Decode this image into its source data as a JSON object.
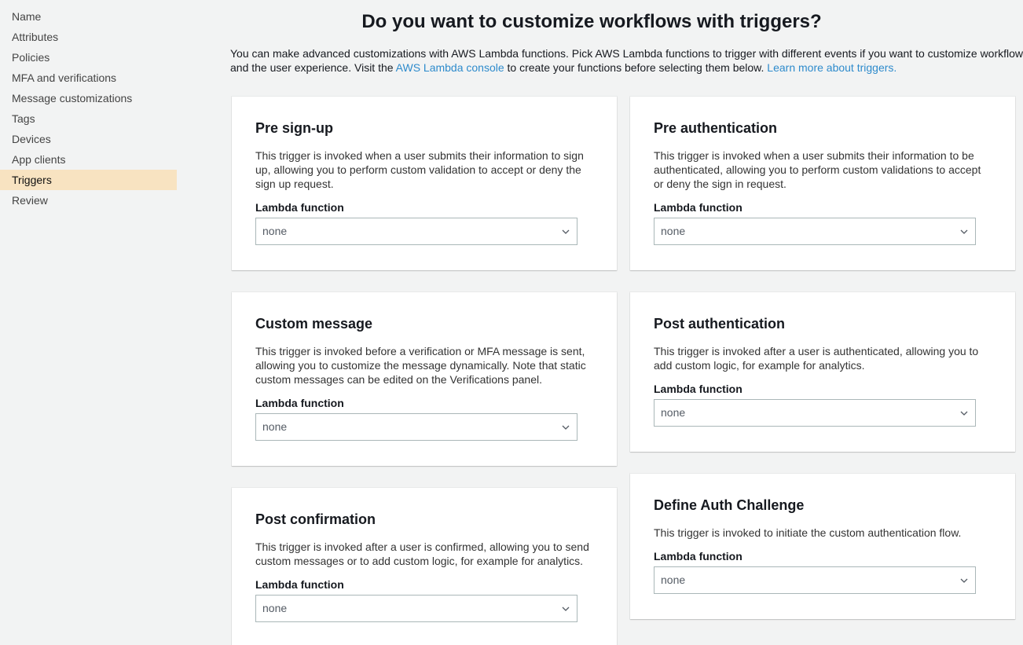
{
  "sidebar": {
    "items": [
      {
        "label": "Name"
      },
      {
        "label": "Attributes"
      },
      {
        "label": "Policies"
      },
      {
        "label": "MFA and verifications"
      },
      {
        "label": "Message customizations"
      },
      {
        "label": "Tags"
      },
      {
        "label": "Devices"
      },
      {
        "label": "App clients"
      },
      {
        "label": "Triggers",
        "active": true
      },
      {
        "label": "Review"
      }
    ]
  },
  "main": {
    "title": "Do you want to customize workflows with triggers?",
    "intro": {
      "line1": "You can make advanced customizations with AWS Lambda functions. Pick AWS Lambda functions to trigger with different events if you want to customize workflows",
      "line2_pre": "and the user experience. Visit the ",
      "link1": "AWS Lambda console",
      "line2_mid": " to create your functions before selecting them below. ",
      "link2": "Learn more about triggers."
    }
  },
  "triggers": {
    "field_label": "Lambda function",
    "pre_signup": {
      "title": "Pre sign-up",
      "description": "This trigger is invoked when a user submits their information to sign up, allowing you to perform custom validation to accept or deny the sign up request.",
      "value": "none"
    },
    "pre_auth": {
      "title": "Pre authentication",
      "description": "This trigger is invoked when a user submits their information to be authenticated, allowing you to perform custom validations to accept or deny the sign in request.",
      "value": "none"
    },
    "custom_message": {
      "title": "Custom message",
      "description": "This trigger is invoked before a verification or MFA message is sent, allowing you to customize the message dynamically. Note that static custom messages can be edited on the Verifications panel.",
      "value": "none"
    },
    "post_auth": {
      "title": "Post authentication",
      "description": "This trigger is invoked after a user is authenticated, allowing you to add custom logic, for example for analytics.",
      "value": "none"
    },
    "post_confirmation": {
      "title": "Post confirmation",
      "description": "This trigger is invoked after a user is confirmed, allowing you to send custom messages or to add custom logic, for example for analytics.",
      "value": "none"
    },
    "define_auth": {
      "title": "Define Auth Challenge",
      "description": "This trigger is invoked to initiate the custom authentication flow.",
      "value": "none"
    }
  }
}
